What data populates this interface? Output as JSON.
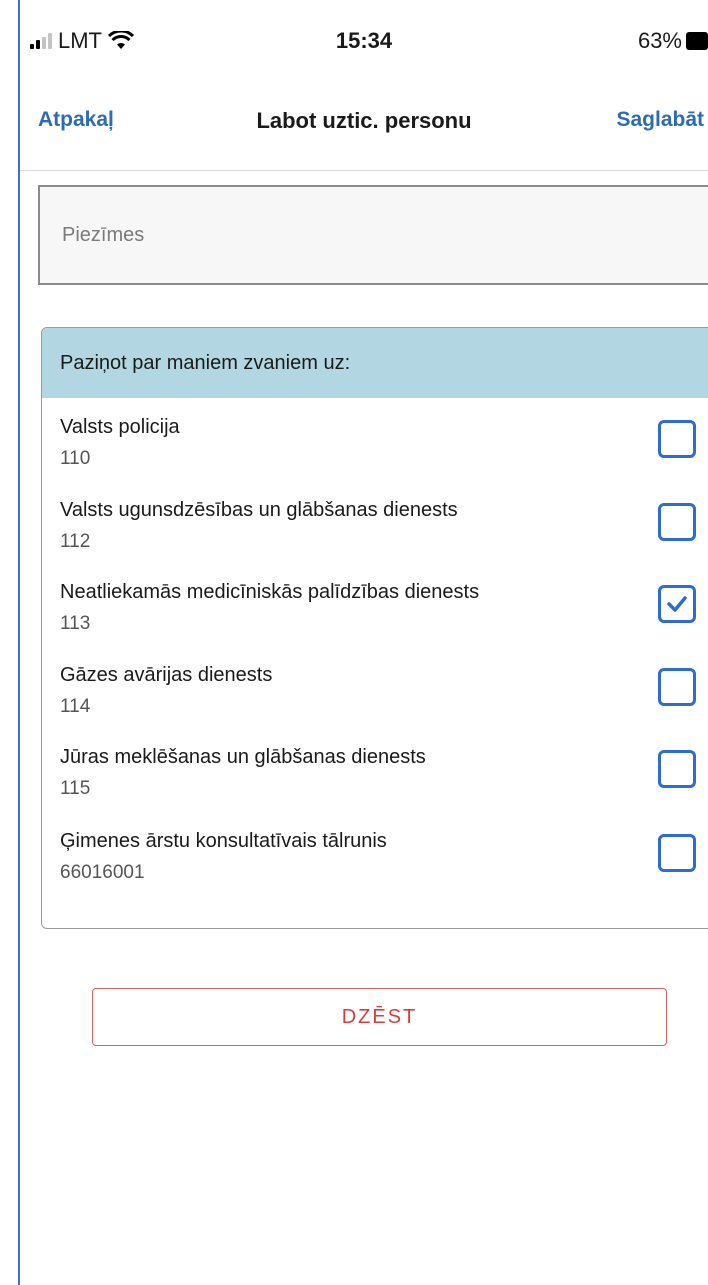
{
  "status_bar": {
    "carrier": "LMT",
    "time": "15:34",
    "battery": "63%"
  },
  "nav": {
    "back_label": "Atpakaļ",
    "title": "Labot uztic. personu",
    "save_label": "Saglabāt"
  },
  "notes": {
    "placeholder": "Piezīmes",
    "value": ""
  },
  "notify": {
    "header": "Paziņot par maniem zvaniem uz:",
    "items": [
      {
        "name": "Valsts policija",
        "number": "110",
        "checked": false
      },
      {
        "name": "Valsts ugunsdzēsības un glābšanas dienests",
        "number": "112",
        "checked": false
      },
      {
        "name": "Neatliekamās medicīniskās palīdzības dienests",
        "number": "113",
        "checked": true
      },
      {
        "name": "Gāzes avārijas dienests",
        "number": "114",
        "checked": false
      },
      {
        "name": "Jūras meklēšanas un glābšanas dienests",
        "number": "115",
        "checked": false
      },
      {
        "name": "Ģimenes ārstu konsultatīvais tālrunis",
        "number": "66016001",
        "checked": false
      }
    ]
  },
  "delete_label": "DZĒST",
  "colors": {
    "accent": "#2d6cb5",
    "checkbox": "#2f6bd6",
    "header_bg": "#b3d7e2",
    "danger": "#e03a3a"
  }
}
